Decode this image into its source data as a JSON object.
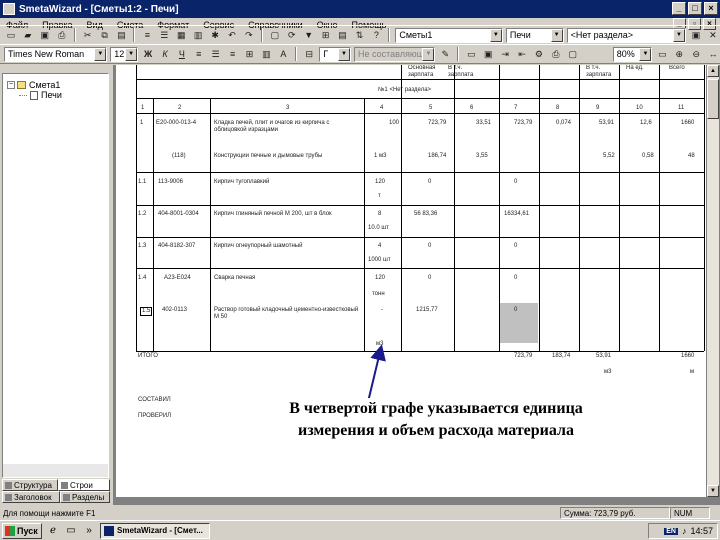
{
  "window": {
    "title": "SmetaWizard - [Сметы1:2 - Печи]"
  },
  "menu": [
    "Файл",
    "Правка",
    "Вид",
    "Смета",
    "Формат",
    "Сервис",
    "Справочники",
    "Окно",
    "Помощь"
  ],
  "toolbar1": {
    "estimate_combo": "Сметы1",
    "section_combo": "Печи",
    "subsection_combo": "<Нет раздела>"
  },
  "toolbar2": {
    "font_combo": "Times New Roman",
    "size_combo": "12",
    "bold": "Ж",
    "italic": "К",
    "underline": "Ч",
    "style_combo": "Г",
    "disabled_combo": "Не составляющие",
    "zoom_combo": "80%"
  },
  "tree": {
    "root": "Смета1",
    "child": "Печи"
  },
  "tabs": [
    "Структура",
    "Строи",
    "Заголовок",
    "Разделы"
  ],
  "sheet": {
    "hdr_col4": "Основная зарплата",
    "hdr_col5": "В т.ч. зарплата",
    "hdr_col8": "В т.ч. зарплата",
    "hdr_col9": "На ед.",
    "hdr_col10": "Всего",
    "section_title": "№1 <Нет раздела>",
    "col_numbers": [
      "1",
      "2",
      "3",
      "4",
      "5",
      "6",
      "7",
      "8",
      "9",
      "10",
      "11"
    ],
    "rows": [
      {
        "n": "1",
        "code": "Е20-000-013-4",
        "name": "Кладка печей, плит и очагов из кирпича с облицовкой изразцами",
        "qty": "100",
        "v5": "723,79",
        "v6": "33,51",
        "v7": "723,79",
        "v8": "0,074",
        "v9": "53,91",
        "v10": "12,6",
        "v11": "1660"
      },
      {
        "n": "",
        "code": "(118)",
        "name": "Конструкции печные и дымовые трубы",
        "qty": "1 м3",
        "v5": "186,74",
        "v6": "3,55",
        "v7": "",
        "v8": "",
        "v9": "5,52",
        "v10": "0,58",
        "v11": "48"
      },
      {
        "n": "1.1",
        "code": "113-9006",
        "name": "Кирпич тугоплавкий",
        "qty": "120",
        "unit": "т",
        "v5": "0",
        "v7": "0"
      },
      {
        "n": "1.2",
        "code": "404-8001-0304",
        "name": "Кирпич глиняный печной М 200, шт в блок",
        "qty": "8",
        "unit": "10.0 шт",
        "v5": "56 83,36",
        "v7": "16334,61"
      },
      {
        "n": "1.3",
        "code": "404-8182-307",
        "name": "Кирпич огнеупорный шамотный",
        "qty": "4",
        "unit": "1000 шт",
        "v5": "0",
        "v7": "0"
      },
      {
        "n": "1.4",
        "code": "А23-Е024",
        "name": "Сварка печная",
        "qty": "120",
        "unit": "тонн",
        "v5": "0",
        "v7": "0"
      },
      {
        "n": "1.5",
        "code": "402-0113",
        "name": "Раствор готовый кладочный цементно-известковый М 50",
        "qty": "-",
        "unit": "м3",
        "v5": "1215,77",
        "v7": "0"
      }
    ],
    "total_label": "ИТОГО",
    "total_v7": "723,79",
    "total_v8": "183,74",
    "total_v9": "53,91",
    "total_v11": "1660",
    "total_sub9": "м3",
    "total_sub11": "м",
    "composed_label": "СОСТАВИЛ",
    "checked_label": "ПРОВЕРИЛ"
  },
  "callout": {
    "line1": "В четвертой графе указывается единица",
    "line2": "измерения и объем расхода материала"
  },
  "status": {
    "hint": "Для помощи нажмите F1",
    "sum": "Сумма: 723,79 руб.",
    "mode": "NUM"
  },
  "taskbar": {
    "start": "Пуск",
    "task": "SmetaWizard - [Смет...",
    "lang": "EN",
    "clock": "14:57"
  }
}
